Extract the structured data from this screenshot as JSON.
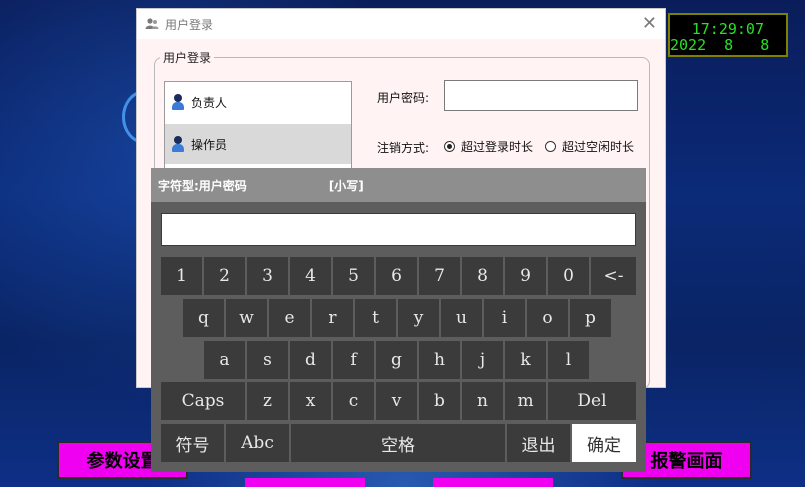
{
  "clock": {
    "time": "17:29:07",
    "date": "2022  8   8"
  },
  "nav": {
    "left_button": "参数设置",
    "right_button": "报警画面"
  },
  "dialog": {
    "title": "用户登录",
    "close_glyph": "✕",
    "group_label": "用户登录",
    "users": [
      "负责人",
      "操作员"
    ],
    "selected_user_index": 1,
    "password_label": "用户密码:",
    "password_value": "",
    "logout_label": "注销方式:",
    "logout_options": [
      "超过登录时长",
      "超过空闲时长"
    ],
    "logout_selected_index": 0
  },
  "keyboard": {
    "header_label": "字符型:用户密码",
    "case_label": "[小写]",
    "input_value": "",
    "row1": [
      "1",
      "2",
      "3",
      "4",
      "5",
      "6",
      "7",
      "8",
      "9",
      "0",
      "<-"
    ],
    "row2": [
      "q",
      "w",
      "e",
      "r",
      "t",
      "y",
      "u",
      "i",
      "o",
      "p"
    ],
    "row3": [
      "a",
      "s",
      "d",
      "f",
      "g",
      "h",
      "j",
      "k",
      "l"
    ],
    "row4": [
      "Caps",
      "z",
      "x",
      "c",
      "v",
      "b",
      "n",
      "m",
      "Del"
    ],
    "row5": [
      "符号",
      "Abc",
      "空格",
      "退出",
      "确定"
    ]
  },
  "colors": {
    "nav_button": "#f000f0",
    "clock_text": "#28e028",
    "keyboard_key": "#3b3b3b"
  }
}
